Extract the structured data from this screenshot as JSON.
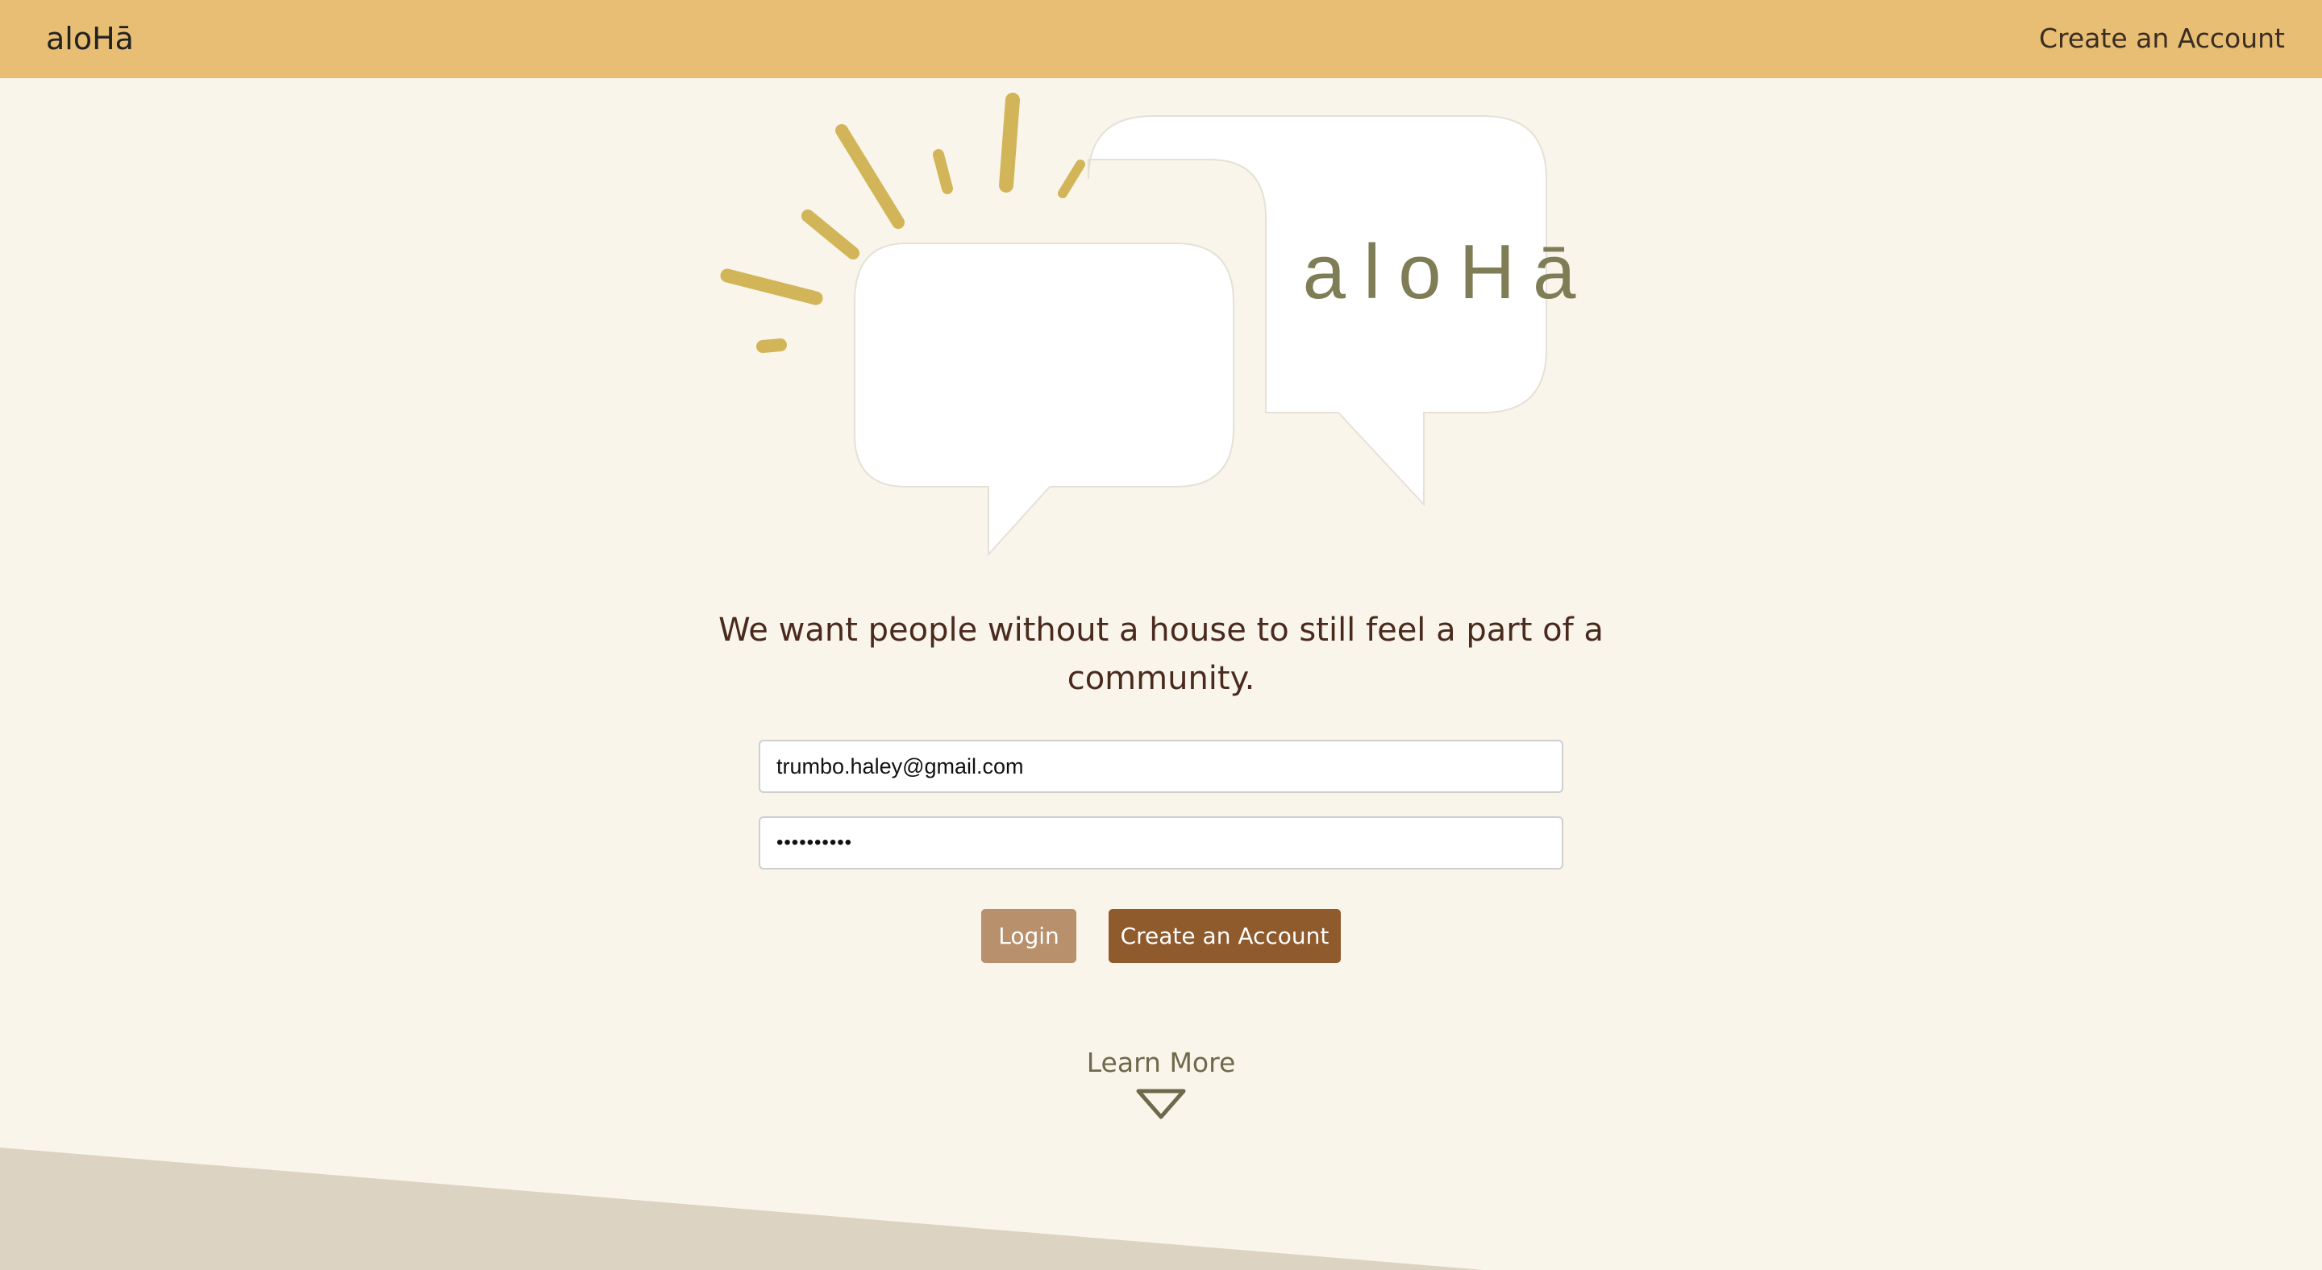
{
  "navbar": {
    "brand": "aloHā",
    "create_account_link": "Create an Account"
  },
  "logo": {
    "wordmark": "aloHā",
    "icon": "speech-bubbles-sunburst-logo"
  },
  "hero": {
    "tagline": "We want people without a house to still feel a part of a community."
  },
  "login_form": {
    "email_value": "trumbo.haley@gmail.com",
    "password_value": "••••••••••",
    "login_label": "Login",
    "create_account_label": "Create an Account"
  },
  "learn_more": {
    "label": "Learn More",
    "icon": "chevron-down-icon"
  },
  "colors": {
    "navbar": "#e8bd74",
    "background": "#f9f5ea",
    "login_button": "#b8906b",
    "create_button": "#8f5a2c",
    "tagline": "#4b2a1e",
    "accent_olive": "#6d6a4c",
    "sunburst": "#d2b558",
    "footer_band": "#dcd3c2"
  }
}
